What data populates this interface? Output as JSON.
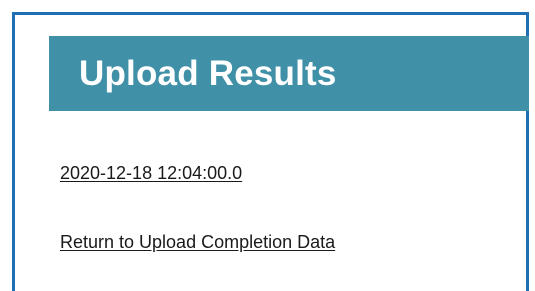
{
  "panel": {
    "title": "Upload Results",
    "header_color": "#4090a8",
    "border_color": "#1f6fb2"
  },
  "links": {
    "timestamp": "2020-12-18 12:04:00.0",
    "return": "Return to Upload Completion Data"
  }
}
